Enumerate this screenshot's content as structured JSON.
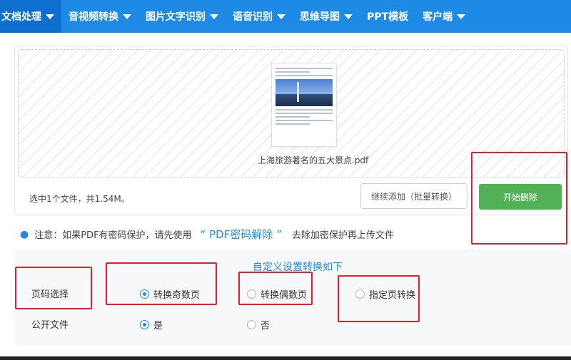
{
  "nav": {
    "items": [
      {
        "label": "文档处理",
        "active": true
      },
      {
        "label": "音视频转换"
      },
      {
        "label": "图片文字识别"
      },
      {
        "label": "语音识别"
      },
      {
        "label": "思维导图"
      },
      {
        "label": "PPT模板"
      },
      {
        "label": "客户端"
      }
    ]
  },
  "upload": {
    "file_name": "上海旅游著名的五大景点.pdf",
    "selected_info": "选中1个文件，共1.54M。",
    "continue_button": "继续添加（批量转换）",
    "start_button": "开始删除"
  },
  "notice": {
    "prefix": "注意：如果PDF有密码保护，请先使用",
    "link": "“ PDF密码解除 ”",
    "suffix": "去除加密保护再上传文件"
  },
  "settings": {
    "title": "自定义设置转换如下",
    "page_select_label": "页码选择",
    "page_options": [
      {
        "label": "转换奇数页",
        "checked": true
      },
      {
        "label": "转换偶数页",
        "checked": false
      },
      {
        "label": "指定页转换",
        "checked": false
      }
    ],
    "public_label": "公开文件",
    "public_options": [
      {
        "label": "是",
        "checked": true
      },
      {
        "label": "否",
        "checked": false
      }
    ]
  },
  "colors": {
    "nav_bg": "#1e8ae6",
    "accent": "#1e8ae6",
    "start_button": "#52b155",
    "annotation": "#e0202a"
  }
}
